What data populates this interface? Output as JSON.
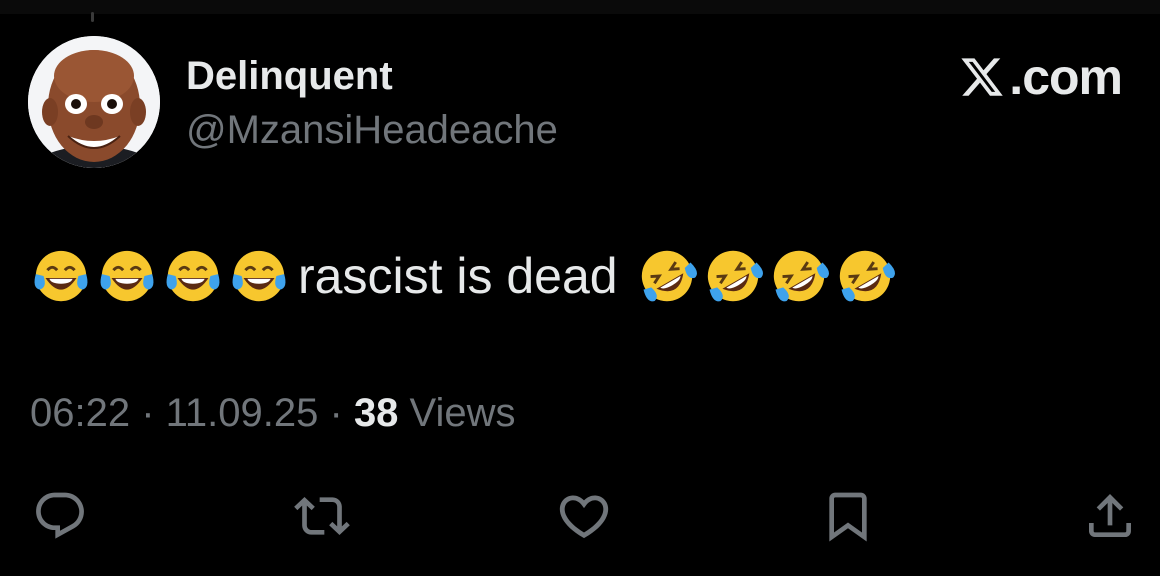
{
  "tweet": {
    "author": {
      "display_name": "Delinquent",
      "handle": "@MzansiHeadeache",
      "avatar_icon": "avatar-photo"
    },
    "brand": {
      "text": "𝕏.com",
      "label": ".com",
      "icon": "x-logo-icon"
    },
    "body": {
      "leading_emoji": [
        "face-with-tears-of-joy",
        "face-with-tears-of-joy",
        "face-with-tears-of-joy",
        "face-with-tears-of-joy"
      ],
      "text": "rascist is dead",
      "trailing_emoji": [
        "rolling-on-the-floor-laughing",
        "rolling-on-the-floor-laughing",
        "rolling-on-the-floor-laughing",
        "rolling-on-the-floor-laughing"
      ]
    },
    "meta": {
      "time": "06:22",
      "separator": " · ",
      "date": "11.09.25",
      "views_count": "38",
      "views_label": " Views"
    },
    "actions": {
      "reply_icon": "reply-icon",
      "retweet_icon": "retweet-icon",
      "like_icon": "heart-icon",
      "bookmark_icon": "bookmark-icon",
      "share_icon": "share-icon"
    }
  },
  "colors": {
    "background": "#000000",
    "primary_text": "#e7e9ea",
    "secondary_text": "#71767b"
  }
}
